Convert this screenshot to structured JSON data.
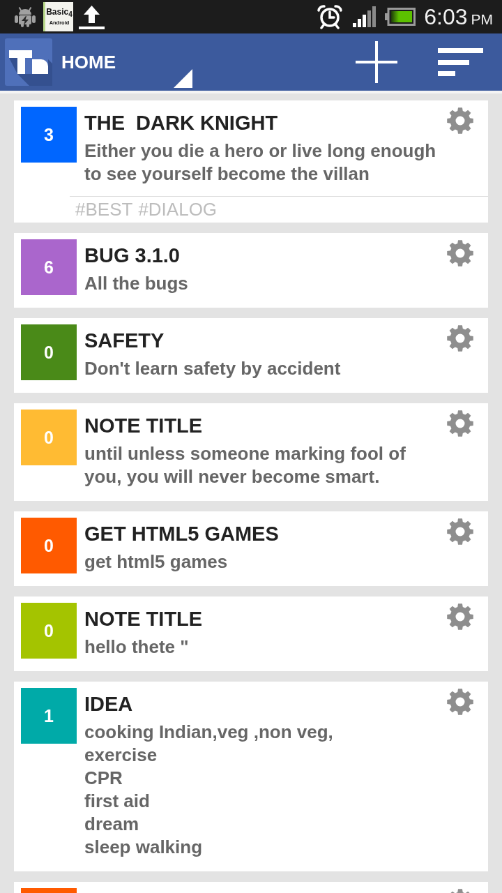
{
  "status_bar": {
    "app_logo": [
      "Basic$_{4}$",
      "Android"
    ],
    "time": "6:03",
    "meridiem": "PM"
  },
  "app_bar": {
    "title": "HOME"
  },
  "notes": [
    {
      "count": "3",
      "color": "#0066ff",
      "title": "THE  DARK KNIGHT",
      "body": "Either you die a hero or live long enough to see yourself become the villan",
      "tags": [
        "#BEST",
        "#DIALOG"
      ]
    },
    {
      "count": "6",
      "color": "#aa66cc",
      "title": "BUG 3.1.0",
      "body": "All the bugs"
    },
    {
      "count": "0",
      "color": "#4a8a18",
      "title": "SAFETY",
      "body": "Don't learn safety by accident"
    },
    {
      "count": "0",
      "color": "#ffbb33",
      "title": "NOTE TITLE",
      "body": "until unless someone marking fool of you, you will never become smart."
    },
    {
      "count": "0",
      "color": "#ff5a00",
      "title": "GET HTML5 GAMES",
      "body": "get html5 games"
    },
    {
      "count": "0",
      "color": "#a4c400",
      "title": "NOTE TITLE",
      "body": "hello thete \""
    },
    {
      "count": "1",
      "color": "#00aaa8",
      "title": "IDEA",
      "body": "cooking Indian,veg ,non veg,\nexercise\nCPR\nfirst aid\ndream\nsleep walking"
    },
    {
      "color": "#ff5a00"
    }
  ]
}
